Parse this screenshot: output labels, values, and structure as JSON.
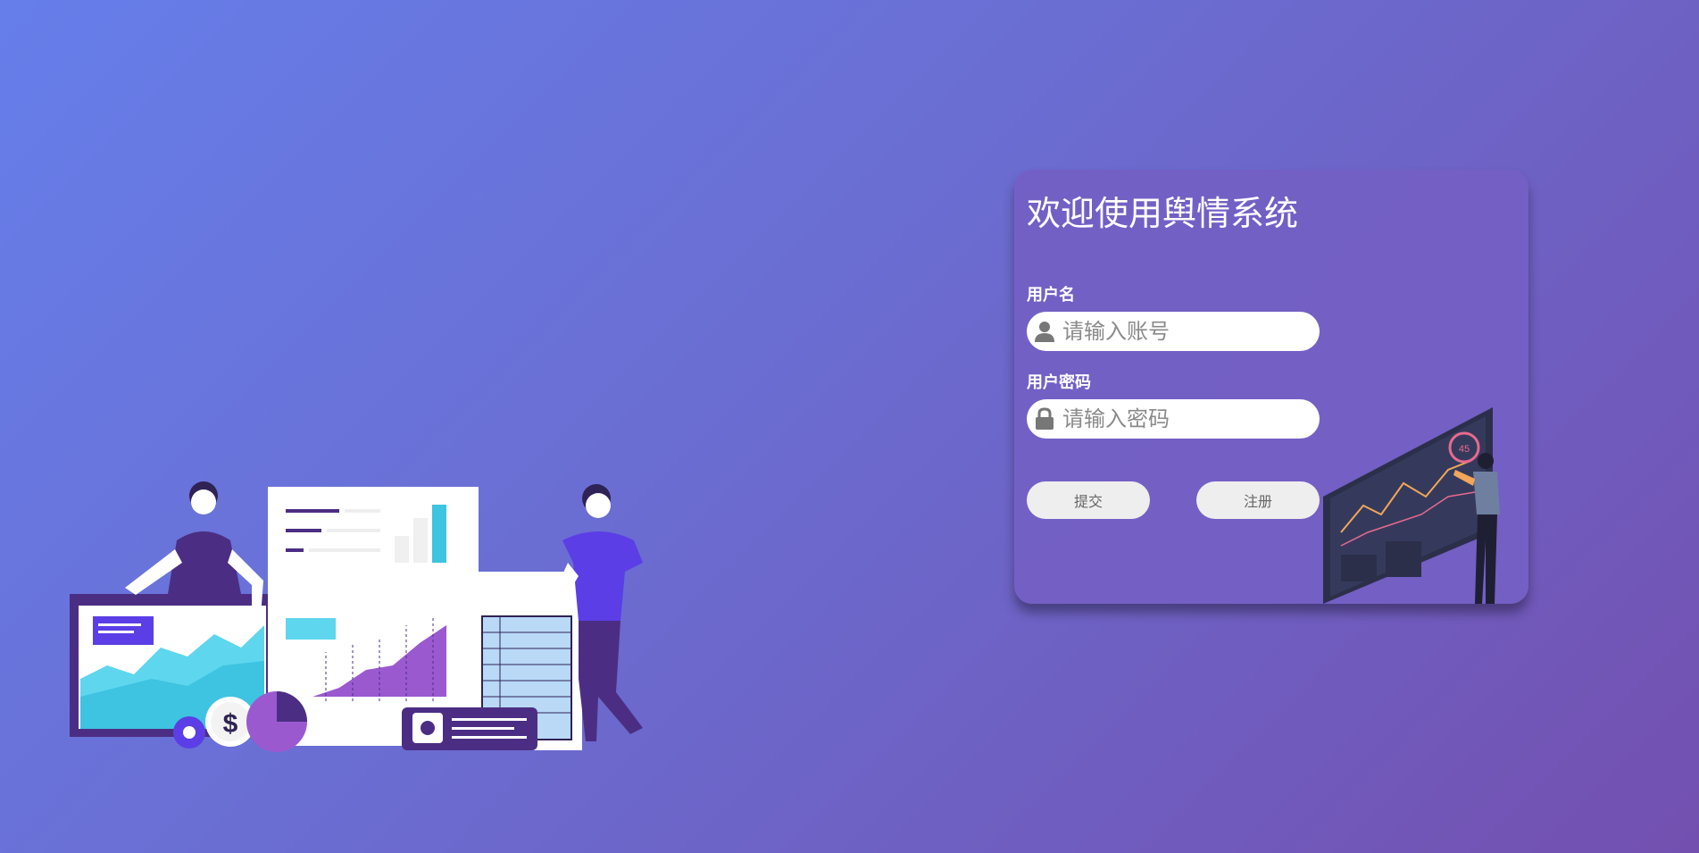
{
  "login": {
    "title": "欢迎使用舆情系统",
    "username_label": "用户名",
    "username_placeholder": "请输入账号",
    "password_label": "用户密码",
    "password_placeholder": "请输入密码",
    "submit_label": "提交",
    "register_label": "注册"
  },
  "illustration": {
    "currency_symbol": "$",
    "gauge_value": "45"
  },
  "icons": {
    "username": "user-icon",
    "password": "lock-icon"
  },
  "colors": {
    "background_start": "#667eea",
    "background_end": "#7350b0",
    "card": "#7460c4",
    "button": "#eeeeee",
    "accent_cyan": "#4dd4ec",
    "accent_purple": "#5b3ee6"
  }
}
